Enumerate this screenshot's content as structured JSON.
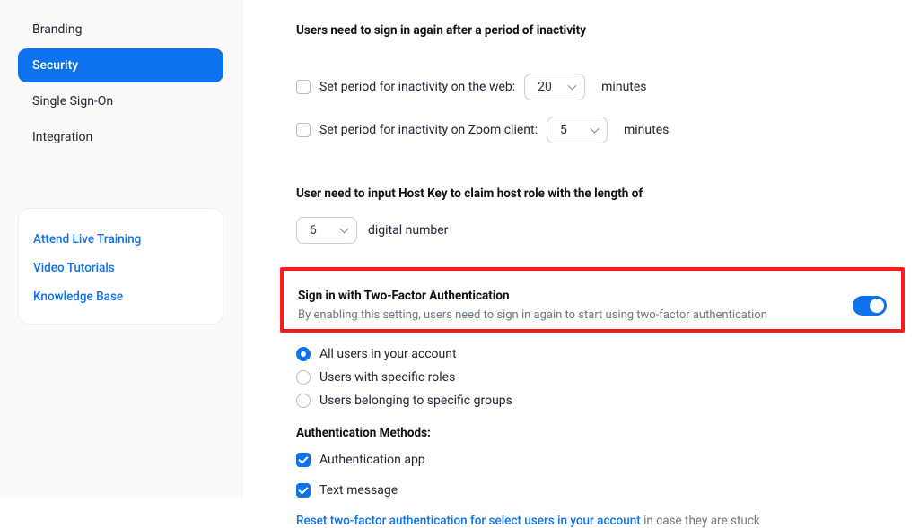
{
  "sidebar": {
    "items": [
      {
        "label": "Branding"
      },
      {
        "label": "Security"
      },
      {
        "label": "Single Sign-On"
      },
      {
        "label": "Integration"
      }
    ],
    "activeIndex": 1,
    "help": [
      {
        "label": "Attend Live Training"
      },
      {
        "label": "Video Tutorials"
      },
      {
        "label": "Knowledge Base"
      }
    ]
  },
  "inactivity": {
    "heading": "Users need to sign in again after a period of inactivity",
    "web": {
      "label": "Set period for inactivity on the web:",
      "value": "20",
      "unit": "minutes"
    },
    "client": {
      "label": "Set period for inactivity on Zoom client:",
      "value": "5",
      "unit": "minutes"
    }
  },
  "hostkey": {
    "heading": "User need to input Host Key to claim host role with the length of",
    "value": "6",
    "suffix": "digital number"
  },
  "tfa": {
    "title": "Sign in with Two-Factor Authentication",
    "description": "By enabling this setting, users need to sign in again to start using two-factor authentication",
    "enabled": true,
    "options": [
      {
        "label": "All users in your account",
        "selected": true
      },
      {
        "label": "Users with specific roles",
        "selected": false
      },
      {
        "label": "Users belonging to specific groups",
        "selected": false
      }
    ],
    "methodsHeading": "Authentication Methods:",
    "methods": [
      {
        "label": "Authentication app",
        "checked": true
      },
      {
        "label": "Text message",
        "checked": true
      }
    ],
    "resetLink": "Reset two-factor authentication for select users in your account",
    "resetTail": " in case they are stuck"
  }
}
